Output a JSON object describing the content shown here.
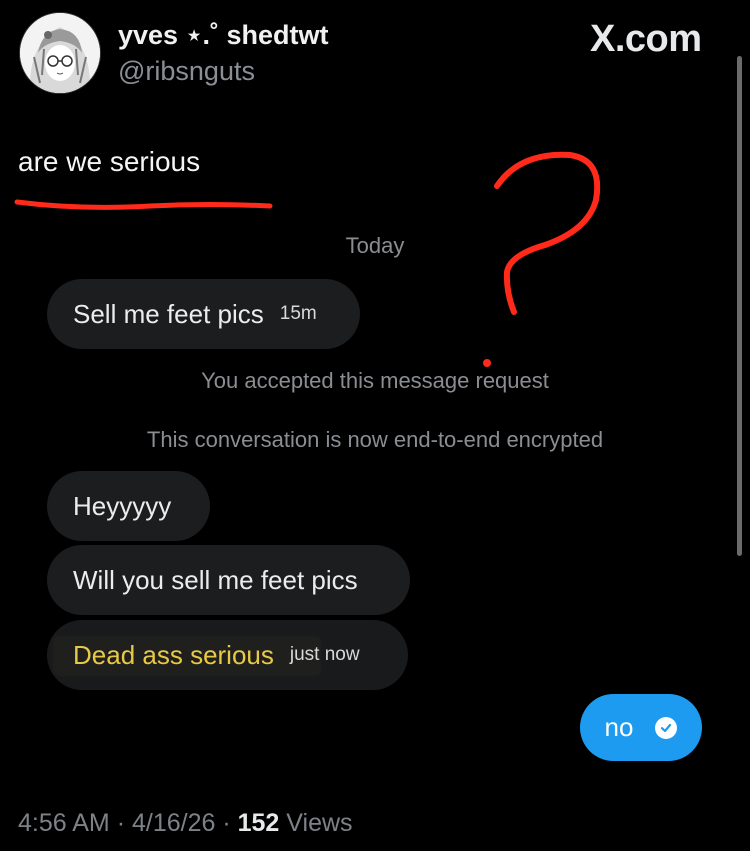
{
  "author": {
    "display_name": "yves ⋆.˚ shedtwt",
    "handle": "@ribsnguts"
  },
  "brand": {
    "label": "X.com"
  },
  "tweet": {
    "text": "are we serious"
  },
  "conversation": {
    "day_label": "Today",
    "messages": [
      {
        "text": "Sell me feet pics",
        "time": "15m"
      },
      {
        "text": "Heyyyyy"
      },
      {
        "text": "Will you sell me feet pics"
      },
      {
        "text": "Dead ass serious",
        "time": "just now"
      }
    ],
    "system": [
      "You accepted this message request",
      "This conversation is now end-to-end encrypted"
    ],
    "sent": {
      "text": "no",
      "icon": "check-circle-icon"
    }
  },
  "meta": {
    "time": "4:56 AM",
    "date": "4/16/26",
    "views_count": "152",
    "views_label": "Views",
    "separator": "·"
  },
  "colors": {
    "background": "#000000",
    "bubble": "#1c1d1f",
    "sent_bubble": "#1d9bf0",
    "highlight_text": "#e8c945",
    "annotation": "#ff2a1a"
  }
}
